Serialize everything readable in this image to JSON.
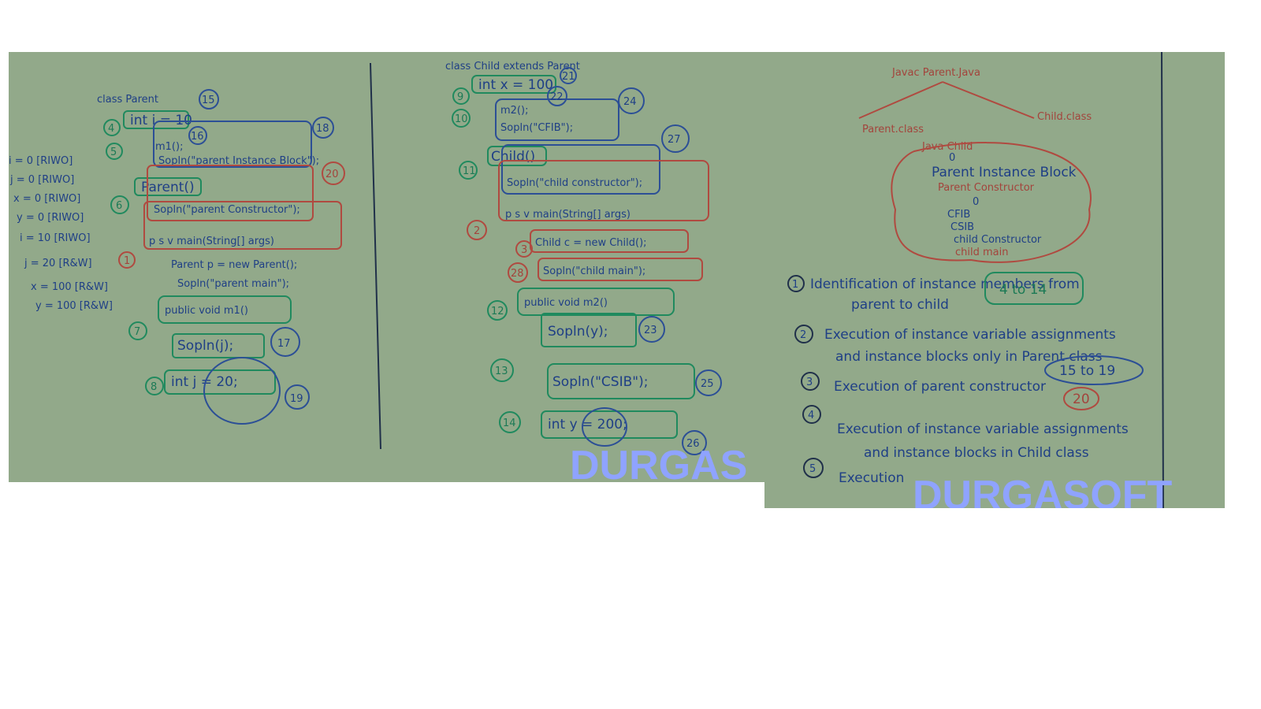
{
  "left_board": {
    "parent_class": {
      "header": "class Parent",
      "var_i": "int i = 10",
      "m1_block": "m1();",
      "sopln_instance": "Sopln(\"parent Instance Block\");",
      "constructor": "Parent()",
      "sopln_constructor": "Sopln(\"parent Constructor\");",
      "main_sig": "p s v main(String[] args)",
      "new_parent": "Parent p = new Parent();",
      "sopln_main": "Sopln(\"parent main\");",
      "method_m1": "public void m1()",
      "sopln_j": "Sopln(j);",
      "var_j": "int j = 20;"
    },
    "step_numbers": {
      "s4": "4",
      "s5": "5",
      "s6": "6",
      "s1": "1",
      "s7": "7",
      "s8": "8",
      "c15": "15",
      "c16": "16",
      "c18": "18",
      "c20": "20",
      "c17": "17",
      "c19": "19"
    },
    "state_list": [
      "i = 0 [RIWO]",
      "j = 0 [RIWO]",
      "x = 0 [RIWO]",
      "y = 0 [RIWO]",
      "i = 10 [RIWO]",
      "j = 20 [R&W]",
      "x = 100 [R&W]",
      "y = 100 [R&W]"
    ],
    "child_class": {
      "header": "class Child extends Parent",
      "var_x": "int x = 100",
      "m2_block": "m2();",
      "sopln_cfib": "Sopln(\"CFIB\");",
      "constructor": "Child()",
      "sopln_constructor": "Sopln(\"child constructor\");",
      "main_sig": "p s v main(String[] args)",
      "new_child": "Child c = new Child();",
      "sopln_main": "Sopln(\"child main\");",
      "method_m2": "public void m2()",
      "sopln_y": "Sopln(y);",
      "sopln_csib": "Sopln(\"CSIB\");",
      "var_y": "int y = 200;"
    },
    "child_steps": {
      "s9": "9",
      "s10": "10",
      "s11": "11",
      "s2": "2",
      "s3": "3",
      "s28": "28",
      "s12": "12",
      "s13": "13",
      "s14": "14",
      "c21": "21",
      "c22": "22",
      "c24": "24",
      "c27": "27",
      "c23": "23",
      "c25": "25",
      "c26": "26"
    },
    "watermark": "DURGAS"
  },
  "right_board": {
    "top": "Javac Parent.Java",
    "parent_class_file": "Parent.class",
    "child_class_file": "Child.class",
    "java_child": "Java Child",
    "flow": [
      "0",
      "Parent Instance Block",
      "Parent Constructor",
      "0",
      "CFIB",
      "CSIB",
      "child Constructor",
      "child main"
    ],
    "rules": [
      {
        "num": "1",
        "text": "Identification of instance members from",
        "text2": "parent to child",
        "range": "4 to 14"
      },
      {
        "num": "2",
        "text": "Execution of instance variable assignments",
        "text2": "and instance blocks only in Parent class",
        "range": "15 to 19"
      },
      {
        "num": "3",
        "text": "Execution of parent constructor",
        "text2": "",
        "range": "20"
      },
      {
        "num": "4",
        "text": "Execution of instance variable assignments",
        "text2": "and instance blocks in Child class",
        "range": ""
      },
      {
        "num": "5",
        "text": "Execution",
        "text2": "",
        "range": ""
      }
    ],
    "watermark": "DURGASOFT"
  },
  "colors": {
    "board": "#92a98a",
    "ink_blue": "#2c4f96",
    "ink_green": "#208a5e",
    "ink_red": "#b04a40",
    "watermark": "#8fa3ff"
  }
}
